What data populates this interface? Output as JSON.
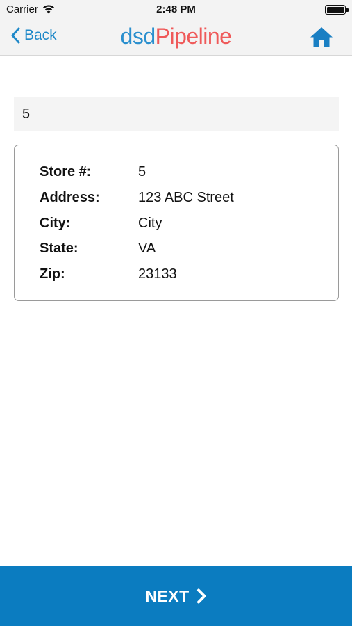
{
  "status_bar": {
    "carrier": "Carrier",
    "time": "2:48 PM",
    "icons": [
      "wifi-icon",
      "battery-icon"
    ]
  },
  "nav": {
    "back_label": "Back",
    "logo_part1": "dsd",
    "logo_part2": "Pipeline",
    "home_icon": "home-icon"
  },
  "search": {
    "value": "5"
  },
  "store": {
    "rows": [
      {
        "label": "Store #:",
        "value": "5"
      },
      {
        "label": "Address:",
        "value": "123 ABC Street"
      },
      {
        "label": "City:",
        "value": "City"
      },
      {
        "label": "State:",
        "value": "VA"
      },
      {
        "label": "Zip:",
        "value": "23133"
      }
    ]
  },
  "footer": {
    "next_label": "NEXT"
  },
  "colors": {
    "brand_blue": "#2a8fce",
    "brand_red": "#ef5a5a",
    "button_blue": "#0b7cc0",
    "nav_bg": "#f3f3f3"
  }
}
